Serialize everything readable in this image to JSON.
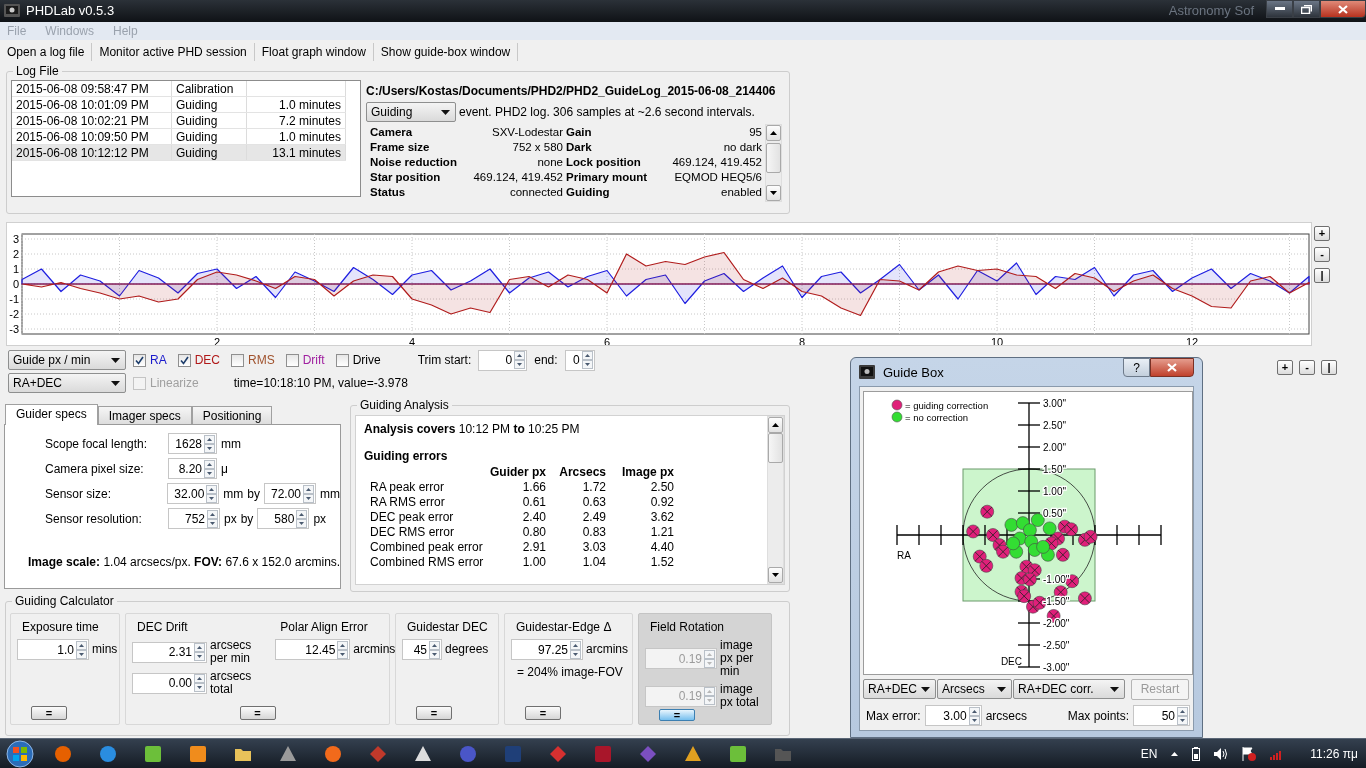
{
  "window": {
    "title": "PHDLab v0.5.3",
    "background_title": "Astronomy Sof"
  },
  "menu": [
    {
      "label": "File",
      "disabled": true
    },
    {
      "label": "Windows",
      "disabled": true
    },
    {
      "label": "Help",
      "disabled": true
    }
  ],
  "toolbar": [
    "Open a log file",
    "Monitor active PHD session",
    "Float graph window",
    "Show guide-box window"
  ],
  "log_file": {
    "title": "Log File",
    "sessions": [
      {
        "time": "2015-06-08 09:58:47 PM",
        "type": "Calibration",
        "selected": false
      },
      {
        "time": "2015-06-08 10:01:09 PM",
        "type": "Guiding",
        "duration": "1.0 minutes",
        "selected": false
      },
      {
        "time": "2015-06-08 10:02:21 PM",
        "type": "Guiding",
        "duration": "7.2 minutes",
        "selected": false
      },
      {
        "time": "2015-06-08 10:09:50 PM",
        "type": "Guiding",
        "duration": "1.0 minutes",
        "selected": false
      },
      {
        "time": "2015-06-08 10:12:12 PM",
        "type": "Guiding",
        "duration": "13.1 minutes",
        "selected": true
      }
    ],
    "path": "C:/Users/Kostas/Documents/PHD2/PHD2_GuideLog_2015-06-08_214406",
    "event_select": "Guiding",
    "event_info": "event. PHD2 log. 306 samples at ~2.6 second intervals.",
    "info": [
      {
        "label": "Camera",
        "value": "SXV-Lodestar"
      },
      {
        "label": "Gain",
        "value": "95"
      },
      {
        "label": "Frame size",
        "value": "752 x 580"
      },
      {
        "label": "Dark",
        "value": "no dark"
      },
      {
        "label": "Noise reduction",
        "value": "none"
      },
      {
        "label": "Lock position",
        "value": "469.124, 419.452"
      },
      {
        "label": "Star position",
        "value": "469.124, 419.452"
      },
      {
        "label": "Primary mount",
        "value": "EQMOD HEQ5/6"
      },
      {
        "label": "Status",
        "value": "connected"
      },
      {
        "label": "Guiding",
        "value": "enabled"
      }
    ]
  },
  "graph": {
    "zoom_buttons": [
      "+",
      "-",
      "|"
    ],
    "chart_data": {
      "type": "area",
      "grid": true,
      "xlim": [
        0,
        13.2
      ],
      "ylim": [
        -3,
        3
      ],
      "xticks": [
        2,
        4,
        6,
        8,
        10,
        12
      ],
      "yticks": [
        -3,
        -2,
        -1,
        0,
        1,
        2,
        3
      ],
      "x": [
        0,
        0.2,
        0.4,
        0.6,
        0.8,
        1,
        1.2,
        1.4,
        1.6,
        1.8,
        2,
        2.2,
        2.4,
        2.6,
        2.8,
        3,
        3.2,
        3.4,
        3.6,
        3.8,
        4,
        4.2,
        4.4,
        4.6,
        4.8,
        5,
        5.2,
        5.4,
        5.6,
        5.8,
        6,
        6.2,
        6.4,
        6.6,
        6.8,
        7,
        7.2,
        7.4,
        7.6,
        7.8,
        8,
        8.2,
        8.4,
        8.6,
        8.8,
        9,
        9.2,
        9.4,
        9.6,
        9.8,
        10,
        10.2,
        10.4,
        10.6,
        10.8,
        11,
        11.2,
        11.4,
        11.6,
        11.8,
        12,
        12.2,
        12.4,
        12.6,
        12.8,
        13,
        13.2
      ],
      "series": [
        {
          "color": "#1f1fe0",
          "values": [
            0.3,
            1.0,
            -0.5,
            0.6,
            0.2,
            -0.8,
            0.9,
            0.4,
            -0.6,
            0.7,
            1.0,
            -0.3,
            0.5,
            -0.9,
            0.8,
            0.2,
            -0.5,
            1.1,
            0.3,
            -0.7,
            0.6,
            0.9,
            -0.4,
            0.2,
            1.0,
            -0.6,
            0.4,
            0.8,
            -0.2,
            0.5,
            0.9,
            -0.8,
            0.3,
            0.6,
            -1.3,
            0.2,
            0.7,
            -0.5,
            0.4,
            1.2,
            -0.9,
            0.5,
            0.8,
            -0.6,
            0.3,
            1.3,
            -0.4,
            0.6,
            -1.0,
            0.9,
            0.2,
            1.4,
            -0.7,
            0.5,
            0.3,
            1.1,
            -0.8,
            0.6,
            0.9,
            -0.5,
            0.4,
            1.0,
            -0.3,
            0.7,
            0.2,
            -0.6,
            0.5
          ]
        },
        {
          "color": "#b01c1c",
          "values": [
            0.0,
            -0.2,
            0.1,
            -0.3,
            -0.6,
            -1.0,
            -0.8,
            -1.2,
            -1.0,
            0.3,
            0.8,
            0.6,
            0.2,
            -0.3,
            0.5,
            0.3,
            -0.8,
            0.2,
            0.6,
            0.5,
            -1.0,
            -1.4,
            -2.0,
            -1.6,
            -1.9,
            0.3,
            0.5,
            -0.2,
            0.6,
            0.3,
            -0.6,
            2.0,
            1.2,
            1.5,
            1.3,
            1.8,
            2.1,
            0.3,
            -0.3,
            0.4,
            -0.5,
            -0.8,
            -1.6,
            -2.1,
            0.3,
            0.2,
            -0.4,
            0.8,
            1.2,
            0.9,
            1.0,
            0.6,
            0.5,
            -0.3,
            0.7,
            0.4,
            -0.5,
            0.2,
            0.6,
            -0.3,
            -0.8,
            -1.5,
            -1.6,
            0.2,
            0.5,
            -0.6,
            0.1
          ]
        }
      ]
    }
  },
  "controls": {
    "scale_select": "Guide px / min",
    "axis_select": "RA+DEC",
    "checks": [
      {
        "label": "RA",
        "checked": true,
        "color": "#1a1acc"
      },
      {
        "label": "DEC",
        "checked": true,
        "color": "#b01818"
      },
      {
        "label": "RMS",
        "checked": false,
        "color": "#a0522d"
      },
      {
        "label": "Drift",
        "checked": false,
        "color": "#a020a0"
      },
      {
        "label": "Drive",
        "checked": false,
        "color": "#000000"
      }
    ],
    "trim_start_label": "Trim start:",
    "trim_start": "0",
    "trim_end_label": "end:",
    "trim_end": "0",
    "linearize": {
      "label": "Linearize",
      "checked": false,
      "disabled": true
    },
    "readout": "time=10:18:10 PM, value=-3.978",
    "zoom_buttons": [
      "+",
      "-",
      "|"
    ]
  },
  "specs": {
    "tabs": [
      {
        "label": "Guider specs",
        "selected": true
      },
      {
        "label": "Imager specs",
        "selected": false
      },
      {
        "label": "Positioning",
        "selected": false
      }
    ],
    "fields": [
      {
        "label": "Scope focal length:",
        "value": "1628",
        "unit": "mm"
      },
      {
        "label": "Camera pixel size:",
        "value": "8.20",
        "unit": "μ"
      },
      {
        "label": "Sensor size:",
        "value": "32.00",
        "unit": "mm",
        "by": "by",
        "value2": "72.00",
        "unit2": "mm"
      },
      {
        "label": "Sensor resolution:",
        "value": "752",
        "unit": "px",
        "by": "by",
        "value2": "580",
        "unit2": "px"
      }
    ],
    "summary": "**Image scale:** 1.04 arcsecs/px. **FOV:** 67.6 x 152.0 arcmins."
  },
  "analysis": {
    "title": "Guiding Analysis",
    "covers": "**Analysis covers** 10:12 PM **to** 10:25 PM",
    "errors_heading": "Guiding errors",
    "columns": [
      "Guider px",
      "Arcsecs",
      "Image px"
    ],
    "rows": [
      {
        "label": "RA peak error",
        "values": [
          "1.66",
          "1.72",
          "2.50"
        ]
      },
      {
        "label": "RA RMS error",
        "values": [
          "0.61",
          "0.63",
          "0.92"
        ]
      },
      {
        "label": "DEC peak error",
        "values": [
          "2.40",
          "2.49",
          "3.62"
        ]
      },
      {
        "label": "DEC RMS error",
        "values": [
          "0.80",
          "0.83",
          "1.21"
        ]
      },
      {
        "label": "Combined peak error",
        "values": [
          "2.91",
          "3.03",
          "4.40"
        ]
      },
      {
        "label": "Combined RMS error",
        "values": [
          "1.00",
          "1.04",
          "1.52"
        ]
      }
    ]
  },
  "calculator": {
    "title": "Guiding Calculator",
    "panels": [
      {
        "highlighted": false,
        "button": {
          "label": "=",
          "focused": false
        },
        "columns": [
          {
            "title": "Exposure time",
            "fields": [
              {
                "value": "1.0",
                "unit": "mins",
                "disabled": false
              }
            ]
          }
        ]
      },
      {
        "highlighted": false,
        "button": {
          "label": "=",
          "focused": false
        },
        "columns": [
          {
            "title": "DEC Drift",
            "fields": [
              {
                "value": "2.31",
                "unit": "arcsecs per min",
                "disabled": false
              },
              {
                "value": "0.00",
                "unit": "arcsecs total",
                "disabled": false
              }
            ]
          },
          {
            "title": "Polar Align Error",
            "fields": [
              {
                "value": "12.45",
                "unit": "arcmins",
                "disabled": false
              }
            ]
          }
        ]
      },
      {
        "highlighted": false,
        "button": {
          "label": "=",
          "focused": false
        },
        "columns": [
          {
            "title": "Guidestar DEC",
            "fields": [
              {
                "value": "45",
                "unit": "degrees",
                "disabled": false
              }
            ]
          }
        ]
      },
      {
        "highlighted": false,
        "button": {
          "label": "=",
          "focused": false
        },
        "columns": [
          {
            "title": "Guidestar-Edge Δ",
            "fields": [
              {
                "value": "97.25",
                "unit": "arcmins",
                "disabled": false
              }
            ],
            "note": "= 204% image-FOV"
          }
        ]
      },
      {
        "highlighted": true,
        "button": {
          "label": "=",
          "focused": true
        },
        "columns": [
          {
            "title": "Field Rotation",
            "fields": [
              {
                "value": "0.19",
                "unit": "image px per min",
                "disabled": true
              },
              {
                "value": "0.19",
                "unit": "image px total",
                "disabled": true
              }
            ]
          }
        ]
      }
    ]
  },
  "guide_box": {
    "title": "Guide Box",
    "help": "?",
    "legend": [
      {
        "label": "= guiding correction",
        "color": "#e0207a"
      },
      {
        "label": "= no correction",
        "color": "#33dd33"
      }
    ],
    "x_axis_label": "RA",
    "y_axis_label": "DEC",
    "tick_labels": [
      "3.00\"",
      "2.50\"",
      "2.00\"",
      "1.50\"",
      "1.00\"",
      "0.50\"",
      "-1.00\"",
      "-1.50\"",
      "-2.00\"",
      "-2.50\"",
      "-3.00\""
    ],
    "selects": [
      "RA+DEC",
      "Arcsecs",
      "RA+DEC corr."
    ],
    "restart": {
      "label": "Restart",
      "disabled": true
    },
    "max_error_label": "Max error:",
    "max_error": "3.00",
    "max_error_unit": "arcsecs",
    "max_points_label": "Max points:",
    "max_points": "50"
  },
  "taskbar": {
    "apps": [
      {
        "kind": "firefox"
      },
      {
        "kind": "ie"
      },
      {
        "kind": "green"
      },
      {
        "kind": "media"
      },
      {
        "kind": "folder"
      },
      {
        "kind": "tool"
      },
      {
        "kind": "orange"
      },
      {
        "kind": "gadget"
      },
      {
        "kind": "pen"
      },
      {
        "kind": "badge"
      },
      {
        "kind": "ps"
      },
      {
        "kind": "paint"
      },
      {
        "kind": "red"
      },
      {
        "kind": "bow"
      },
      {
        "kind": "hourglass"
      },
      {
        "kind": "green"
      },
      {
        "kind": "monitor"
      }
    ],
    "language": "EN",
    "clock": "11:26 πμ"
  }
}
